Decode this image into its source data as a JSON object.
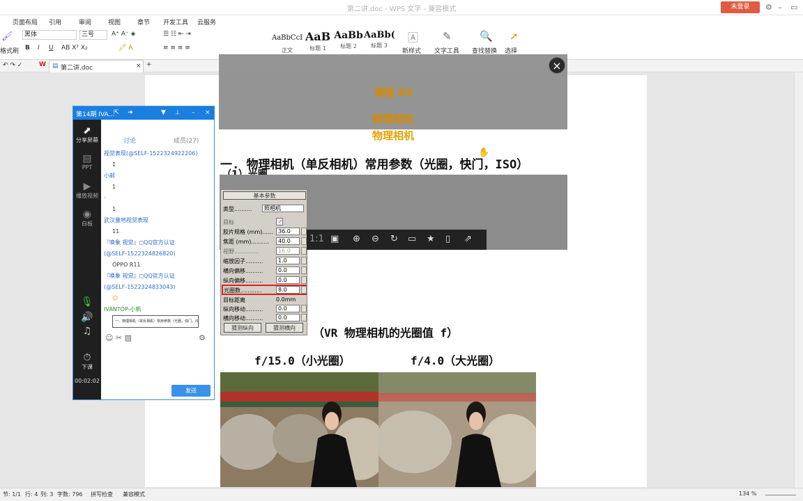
{
  "window": {
    "title": "第二讲.doc - WPS 文字 - 兼容模式",
    "login_label": "未登录"
  },
  "menu_tabs": [
    "页面布局",
    "引用",
    "审阅",
    "视图",
    "章节",
    "开发工具",
    "云服务"
  ],
  "ribbon": {
    "format_painter": "格式刷",
    "font_name": "黑体",
    "font_size": "三号",
    "style_preview": [
      "AaBbCcD",
      "AaB",
      "AaBb",
      "AaBb("
    ],
    "style_names": [
      "正文",
      "标题 1",
      "标题 2",
      "标题 3"
    ],
    "new_style": "新样式",
    "text_tools": "文字工具",
    "find_replace": "查找替换",
    "select": "选择"
  },
  "doc_tab": {
    "name": "第二讲.doc"
  },
  "chat": {
    "title": "第14期 IVA...",
    "tabs": [
      "讨论",
      "成员(27)"
    ],
    "side": [
      "分享屏幕",
      "PPT",
      "播放视频",
      "白板",
      "下课"
    ],
    "timer": "00:02:02",
    "messages": [
      {
        "name": "视觉表现(@SELF-1522324922206)",
        "text": "1"
      },
      {
        "name": "小邮",
        "text": "1"
      },
      {
        "name": "·",
        "text": "1"
      },
      {
        "name": "武汉量地视觉表现",
        "text": "11"
      },
      {
        "name": "『唤象 视觉』◻QQ官方认证",
        "text": ""
      },
      {
        "name": "(@SELF-1522324826820)",
        "text": "OPPO R11"
      },
      {
        "name": "『唤象 视觉』◻QQ官方认证",
        "text": ""
      },
      {
        "name": "(@SELF-1522324833043)",
        "text": "☺"
      },
      {
        "name": "IVANTOP-小帆",
        "text": ""
      }
    ],
    "thumb_text": "一、物理相机（单反相机）常用参数（光圈，快门，ISO）",
    "send_label": "发送"
  },
  "overlay": {
    "title": "课程 02",
    "subtitle": "物理相机",
    "subtitle2": "物理相机"
  },
  "document": {
    "heading": "一. 物理相机（单反相机）常用参数（光圈，快门，ISO）",
    "subheading": "（1）光圈",
    "caption": "（VR 物理相机的光圈值 f）",
    "f_small": "f/15.0（小光圈）",
    "f_large": "f/4.0（大光圈）"
  },
  "params_panel": {
    "header": "基本参数",
    "rows": [
      {
        "label": "类型..........",
        "value": "照相机"
      },
      {
        "label": "目标",
        "value": "✓"
      },
      {
        "label": "胶片规格 (mm)......",
        "value": "36.0"
      },
      {
        "label": "焦距 (mm)..........",
        "value": "40.0"
      },
      {
        "label": "视野..............",
        "value": "16.0"
      },
      {
        "label": "缩放因子..........",
        "value": "1.0"
      },
      {
        "label": "横向偏移..........",
        "value": "0.0"
      },
      {
        "label": "纵向偏移..........",
        "value": "0.0"
      },
      {
        "label": "光圈数............",
        "value": "8.0"
      },
      {
        "label": "目标距离",
        "value": "0.0mm"
      },
      {
        "label": "纵向移动..........",
        "value": "0.0"
      },
      {
        "label": "横向移动..........",
        "value": "0.0"
      }
    ],
    "btn_vertical": "猜测纵向",
    "btn_horizontal": "猜测横向"
  },
  "viewer": {
    "ratio_label": "1:1"
  },
  "statusbar": {
    "section": "节: 1/1",
    "row": "行: 4",
    "col": "列: 3",
    "words": "字数: 796",
    "spell": "拼写检查",
    "mode": "兼容模式",
    "zoom": "134 %"
  },
  "colors": {
    "chat_blue": "#1a7fe0",
    "overlay_gold": "#d88a00",
    "highlight_red": "#e02020"
  }
}
